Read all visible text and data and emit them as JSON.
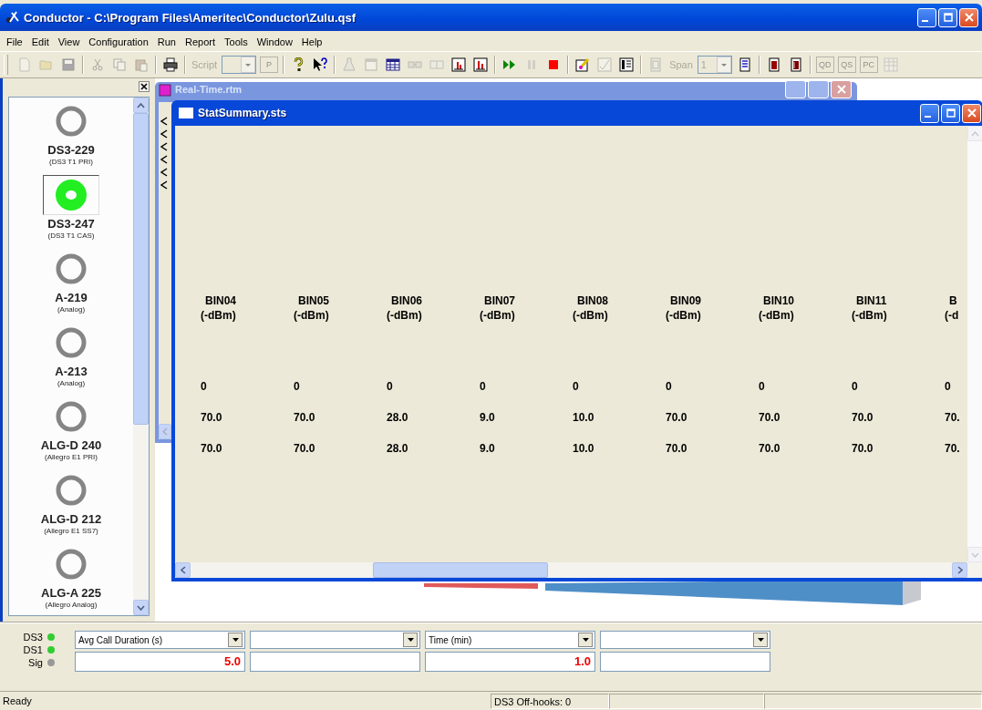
{
  "window": {
    "title": "Conductor - C:\\Program Files\\Ameritec\\Conductor\\Zulu.qsf"
  },
  "menu": [
    "File",
    "Edit",
    "View",
    "Configuration",
    "Run",
    "Report",
    "Tools",
    "Window",
    "Help"
  ],
  "toolbar": [
    {
      "kind": "button",
      "disabled": true
    },
    {
      "kind": "button",
      "disabled": true
    },
    {
      "kind": "button",
      "disabled": true
    },
    {
      "kind": "separator"
    },
    {
      "kind": "button",
      "disabled": true
    },
    {
      "kind": "button",
      "disabled": true
    },
    {
      "kind": "button",
      "disabled": true
    },
    {
      "kind": "separator"
    },
    {
      "kind": "button",
      "disabled": false
    },
    {
      "kind": "separator"
    },
    {
      "kind": "label",
      "text": "Script",
      "disabled": true
    },
    {
      "kind": "combo",
      "disabled": true
    },
    {
      "kind": "text-button",
      "text": "P",
      "disabled": true
    },
    {
      "kind": "separator"
    },
    {
      "kind": "button",
      "disabled": false
    },
    {
      "kind": "button",
      "disabled": false
    },
    {
      "kind": "separator"
    },
    {
      "kind": "button",
      "disabled": true
    },
    {
      "kind": "button",
      "disabled": true
    },
    {
      "kind": "button",
      "disabled": false
    },
    {
      "kind": "button",
      "disabled": true
    },
    {
      "kind": "button",
      "disabled": true
    },
    {
      "kind": "button",
      "disabled": false
    },
    {
      "kind": "button",
      "disabled": false
    },
    {
      "kind": "separator"
    },
    {
      "kind": "button",
      "disabled": false
    },
    {
      "kind": "button",
      "disabled": true
    },
    {
      "kind": "button",
      "disabled": false
    },
    {
      "kind": "separator"
    },
    {
      "kind": "button",
      "disabled": false
    },
    {
      "kind": "button",
      "disabled": true
    },
    {
      "kind": "button",
      "disabled": false
    },
    {
      "kind": "separator"
    },
    {
      "kind": "button",
      "disabled": true
    },
    {
      "kind": "label",
      "text": "Span",
      "disabled": true
    },
    {
      "kind": "combo",
      "text": "1",
      "disabled": true
    },
    {
      "kind": "button",
      "disabled": false
    },
    {
      "kind": "separator"
    },
    {
      "kind": "button",
      "disabled": false
    },
    {
      "kind": "button",
      "disabled": false
    },
    {
      "kind": "separator"
    },
    {
      "kind": "text-button",
      "text": "QD",
      "disabled": true
    },
    {
      "kind": "text-button",
      "text": "QS",
      "disabled": true
    },
    {
      "kind": "text-button",
      "text": "PC",
      "disabled": true
    },
    {
      "kind": "button",
      "disabled": true
    }
  ],
  "devices": [
    {
      "name": "DS3-229",
      "type": "(DS3 T1 PRI)",
      "on": false,
      "selected": false
    },
    {
      "name": "DS3-247",
      "type": "(DS3 T1 CAS)",
      "on": true,
      "selected": true
    },
    {
      "name": "A-219",
      "type": "(Analog)",
      "on": false,
      "selected": false
    },
    {
      "name": "A-213",
      "type": "(Analog)",
      "on": false,
      "selected": false
    },
    {
      "name": "ALG-D 240",
      "type": "(Allegro E1 PRI)",
      "on": false,
      "selected": false
    },
    {
      "name": "ALG-D 212",
      "type": "(Allegro E1 SS7)",
      "on": false,
      "selected": false
    },
    {
      "name": "ALG-A 225",
      "type": "(Allegro Analog)",
      "on": false,
      "selected": false
    }
  ],
  "background_window": {
    "title": "Real-Time.rtm"
  },
  "stat_window": {
    "title": "StatSummary.sts",
    "columns": [
      {
        "heading": "BIN04",
        "unit": "(-dBm)",
        "values": [
          "0",
          "70.0",
          "70.0"
        ]
      },
      {
        "heading": "BIN05",
        "unit": "(-dBm)",
        "values": [
          "0",
          "70.0",
          "70.0"
        ]
      },
      {
        "heading": "BIN06",
        "unit": "(-dBm)",
        "values": [
          "0",
          "28.0",
          "28.0"
        ]
      },
      {
        "heading": "BIN07",
        "unit": "(-dBm)",
        "values": [
          "0",
          "9.0",
          "9.0"
        ]
      },
      {
        "heading": "BIN08",
        "unit": "(-dBm)",
        "values": [
          "0",
          "10.0",
          "10.0"
        ]
      },
      {
        "heading": "BIN09",
        "unit": "(-dBm)",
        "values": [
          "0",
          "70.0",
          "70.0"
        ]
      },
      {
        "heading": "BIN10",
        "unit": "(-dBm)",
        "values": [
          "0",
          "70.0",
          "70.0"
        ]
      },
      {
        "heading": "BIN11",
        "unit": "(-dBm)",
        "values": [
          "0",
          "70.0",
          "70.0"
        ]
      },
      {
        "heading": "B",
        "unit": "(-d",
        "values": [
          "0",
          "70.",
          "70."
        ]
      }
    ]
  },
  "indicators": [
    {
      "label": "DS3",
      "color": "#33cc33"
    },
    {
      "label": "DS1",
      "color": "#33cc33"
    },
    {
      "label": "Sig",
      "color": "#999999"
    }
  ],
  "meters": [
    {
      "dropdown": "Avg Call Duration (s)",
      "value": "5.0"
    },
    {
      "dropdown": "Time (min)",
      "value": "1.0"
    }
  ],
  "status_bar": [
    "Ready",
    "DS3 Off-hooks: 0"
  ]
}
